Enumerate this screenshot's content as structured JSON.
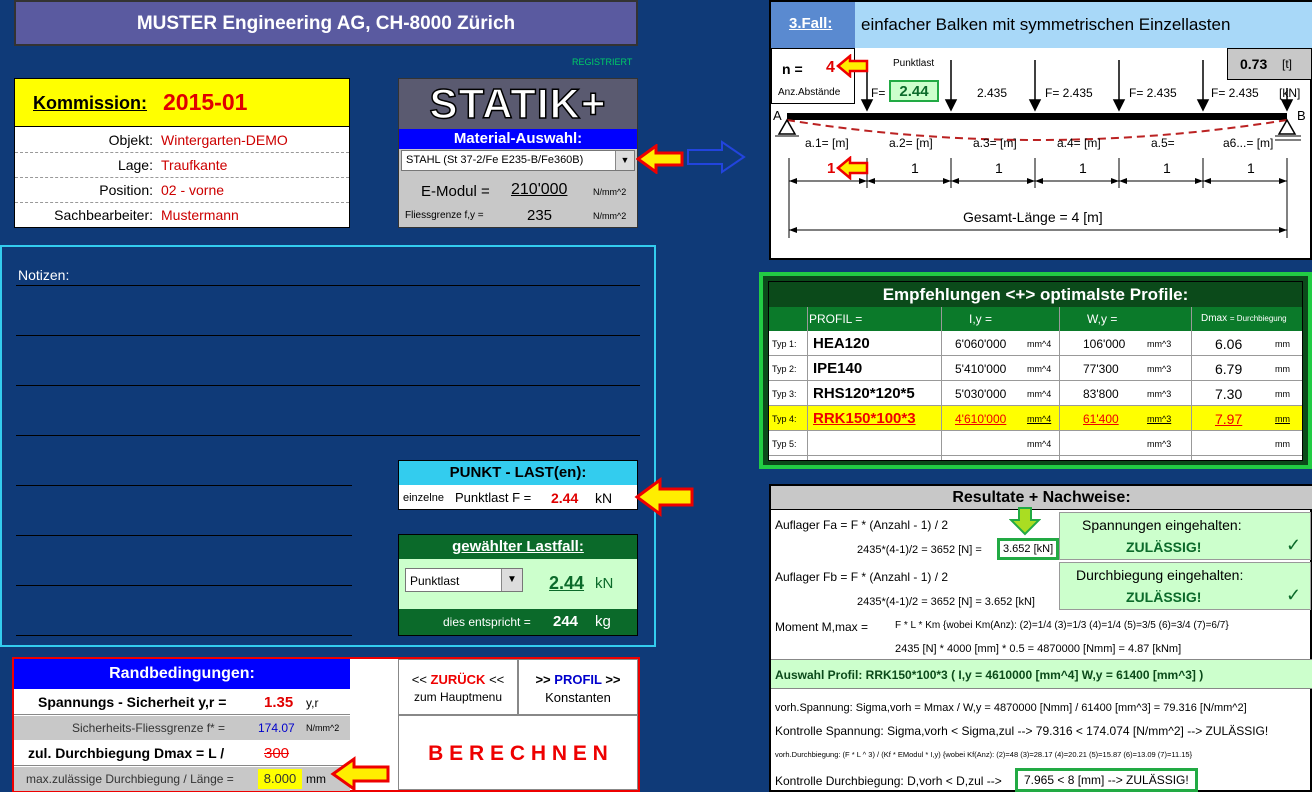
{
  "header": {
    "title": "MUSTER Engineering AG, CH-8000 Zürich",
    "registered": "REGISTRIERT"
  },
  "project": {
    "kommission_label": "Kommission:",
    "kommission_value": "2015-01",
    "rows": [
      {
        "label": "Objekt:",
        "value": "Wintergarten-DEMO"
      },
      {
        "label": "Lage:",
        "value": "Traufkante"
      },
      {
        "label": "Position:",
        "value": "02 - vorne"
      },
      {
        "label": "Sachbearbeiter:",
        "value": "Mustermann"
      }
    ]
  },
  "material": {
    "logo": "STATIK+",
    "title": "Material-Auswahl:",
    "select_value": "STAHL  (St 37-2/Fe E235-B/Fe360B)",
    "emodul_label": "E-Modul =",
    "emodul_value": "210'000",
    "emodul_unit": "N/mm^2",
    "fy_label": "Fliessgrenze f,y =",
    "fy_value": "235",
    "fy_unit": "N/mm^2"
  },
  "notes": {
    "label": "Notizen:"
  },
  "punktlast": {
    "title": "PUNKT - LAST(en):",
    "small_label": "einzelne",
    "label": "Punktlast F =",
    "value": "2.44",
    "unit": "kN"
  },
  "lastfall": {
    "title": "gewählter Lastfall:",
    "select_value": "Punktlast",
    "value": "2.44",
    "unit": "kN",
    "equiv_label": "dies entspricht =",
    "equiv_value": "244",
    "equiv_unit": "kg"
  },
  "rand": {
    "title": "Randbedingungen:",
    "sicherheit_label": "Spannungs - Sicherheit y,r =",
    "sicherheit_value": "1.35",
    "sicherheit_unit": "y,r",
    "fliess_label": "Sicherheits-Fliessgrenze f* =",
    "fliess_value": "174.07",
    "fliess_unit": "N/mm^2",
    "durch_label": "zul. Durchbiegung Dmax = L /",
    "durch_value": "300",
    "max_label": "max.zulässige Durchbiegung / Länge =",
    "max_value": "8.000",
    "max_unit": "mm"
  },
  "nav": {
    "back_arrows_l": "<<",
    "back_label": "ZURÜCK",
    "back_arrows_r": "<<",
    "back_sub": "zum Hauptmenu",
    "profil_arrows_l": ">>",
    "profil_label": "PROFIL",
    "profil_arrows_r": ">>",
    "profil_sub": "Konstanten",
    "berechnen": "B E R E C H N E N"
  },
  "fall": {
    "link": "3.Fall:",
    "title": "einfacher Balken mit symmetrischen Einzellasten",
    "n_label": "n =",
    "n_value": "4",
    "anz_label": "Anz.Abstände",
    "punktlast_label": "Punktlast",
    "f_label": "F=",
    "f_value": "2.44",
    "loads": [
      "2.435",
      "F= 2.435",
      "F= 2.435",
      "F= 2.435"
    ],
    "load_unit": "[kN]",
    "t_value": "0.73",
    "t_unit": "[t]",
    "support_a": "A",
    "support_b": "B",
    "spans": [
      "a.1= [m]",
      "a.2= [m]",
      "a.3= [m]",
      "a.4= [m]",
      "a.5=",
      "a6...= [m]"
    ],
    "span_values": [
      "1",
      "1",
      "1",
      "1",
      "1",
      "1"
    ],
    "gesamt": "Gesamt-Länge = 4 [m]"
  },
  "empf": {
    "title": "Empfehlungen <+> optimalste Profile:",
    "headers": [
      "PROFIL =",
      "I,y =",
      "W,y =",
      "Dmax",
      "= Durchbiegung"
    ],
    "rows": [
      {
        "typ": "Typ 1:",
        "profil": "HEA120",
        "iy": "6'060'000",
        "iy_unit": "mm^4",
        "wy": "106'000",
        "wy_unit": "mm^3",
        "d": "6.06",
        "d_unit": "mm"
      },
      {
        "typ": "Typ 2:",
        "profil": "IPE140",
        "iy": "5'410'000",
        "iy_unit": "mm^4",
        "wy": "77'300",
        "wy_unit": "mm^3",
        "d": "6.79",
        "d_unit": "mm"
      },
      {
        "typ": "Typ 3:",
        "profil": "RHS120*120*5",
        "iy": "5'030'000",
        "iy_unit": "mm^4",
        "wy": "83'800",
        "wy_unit": "mm^3",
        "d": "7.30",
        "d_unit": "mm"
      },
      {
        "typ": "Typ 4:",
        "profil": "RRK150*100*3",
        "iy": "4'610'000",
        "iy_unit": "mm^4",
        "wy": "61'400",
        "wy_unit": "mm^3",
        "d": "7.97",
        "d_unit": "mm"
      },
      {
        "typ": "Typ 5:",
        "profil": "",
        "iy": "",
        "iy_unit": "mm^4",
        "wy": "",
        "wy_unit": "mm^3",
        "d": "",
        "d_unit": "mm"
      }
    ]
  },
  "res": {
    "title": "Resultate + Nachweise:",
    "fa_line1": "Auflager Fa =  F * (Anzahl - 1) / 2",
    "fa_line2": "2435*(4-1)/2 = 3652 [N] =",
    "fa_value": "3.652 [kN]",
    "fb_line1": "Auflager Fb =  F * (Anzahl - 1) / 2",
    "fb_line2": "2435*(4-1)/2 = 3652 [N] = 3.652 [kN]",
    "span_ok": "Spannungen eingehalten:",
    "span_zul": "ZULÄSSIG!",
    "durch_ok": "Durchbiegung eingehalten:",
    "durch_zul": "ZULÄSSIG!",
    "check": "✓",
    "moment_label": "Moment M,max =",
    "moment_formula": "F * L * Km  {wobei Km(Anz): (2)=1/4 (3)=1/3 (4)=1/4 (5)=3/5 (6)=3/4 (7)=6/7}",
    "moment_line2": "2435 [N] * 4000 [mm] * 0.5 = 4870000 [Nmm] = 4.87 [kNm]",
    "auswahl": "Auswahl Profil: RRK150*100*3 ( I,y = 4610000 [mm^4]  W,y = 61400 [mm^3] )",
    "vorh_sp": "vorh.Spannung: Sigma,vorh = Mmax / W,y = 4870000 [Nmm] / 61400 [mm^3] = 79.316 [N/mm^2]",
    "kontr_sp": "Kontrolle Spannung: Sigma,vorh < Sigma,zul --> 79.316 < 174.074 [N/mm^2] --> ZULÄSSIG!",
    "vorh_db": "vorh.Durchbiegung: (F * L ^ 3) / (Kf * EModul * I,y)  {wobei Kf(Anz): (2)=48 (3)=28.17 (4)=20.21 (5)=15.87 (6)=13.09 (7)=11.15}",
    "kontr_db_label": "Kontrolle Durchbiegung: D,vorh < D,zul -->",
    "kontr_db_value": "7.965 < 8 [mm] --> ZULÄSSIG!"
  },
  "colors": {
    "bg": "#0f3a78",
    "yellow": "#ffff00",
    "green_dark": "#0b6a2a",
    "cyan": "#33ccee",
    "blue": "#0000ff",
    "red": "#e00000"
  }
}
